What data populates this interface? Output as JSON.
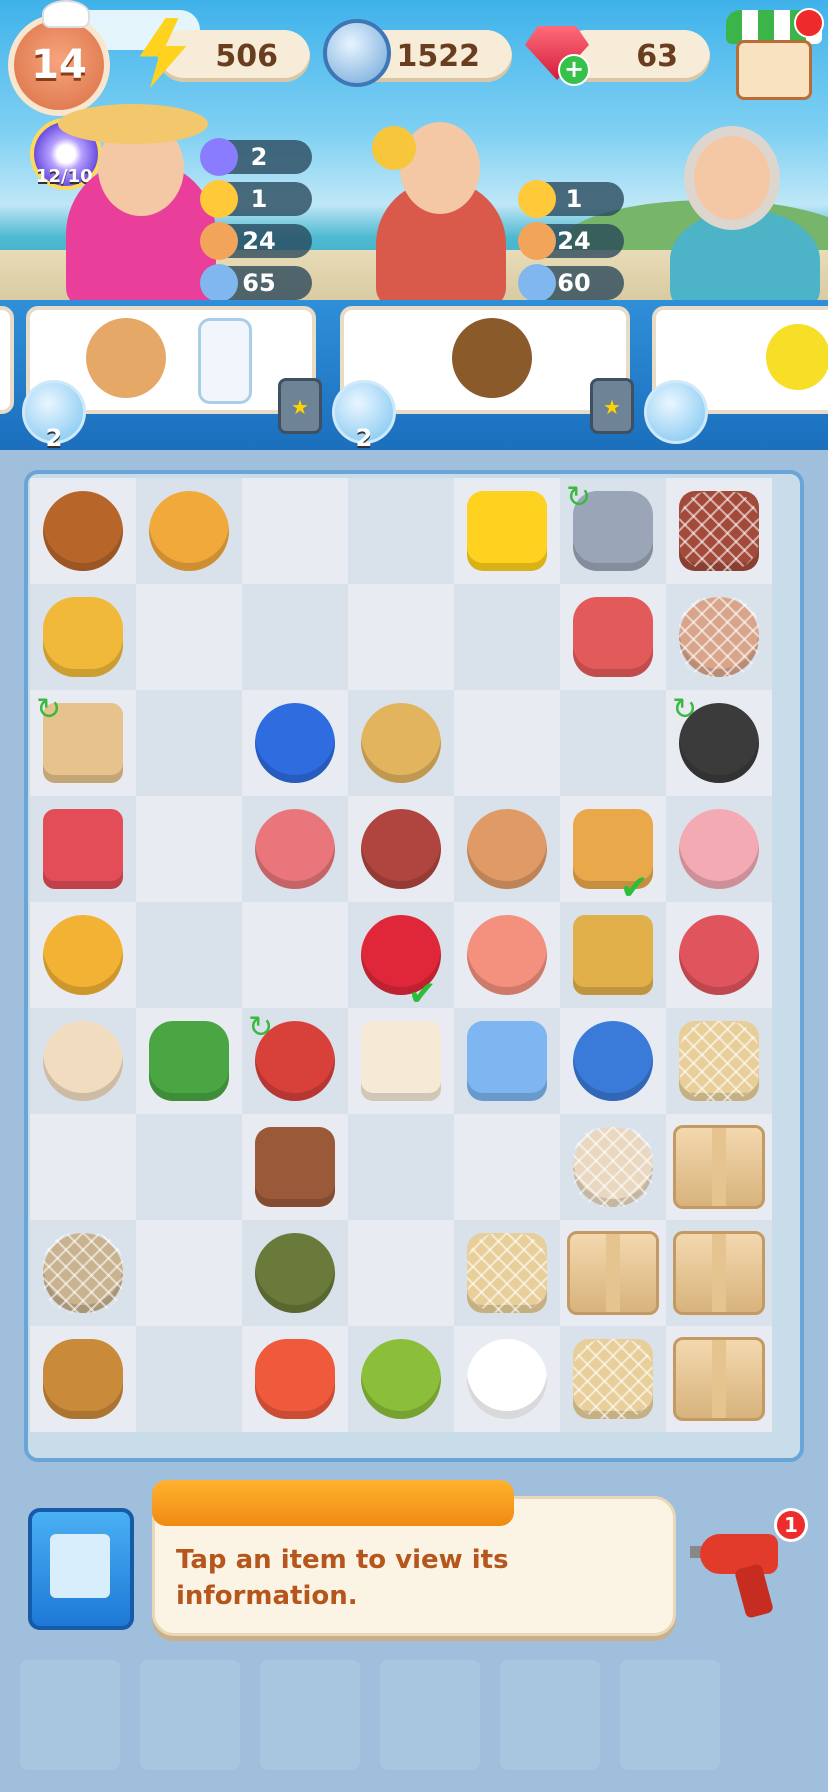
{
  "hud": {
    "level": "14",
    "energy": "506",
    "coins": "1522",
    "gems": "63"
  },
  "booster": {
    "count": "12/10"
  },
  "customers": [
    {
      "name": "customer-1",
      "stats": [
        "2",
        "1",
        "24",
        "65"
      ]
    },
    {
      "name": "customer-2",
      "stats": [
        "1",
        "24",
        "60"
      ]
    },
    {
      "name": "customer-3",
      "stats": []
    }
  ],
  "orders": [
    {
      "items": [
        "grilled-steak-icon",
        "milk-bottle-icon"
      ],
      "pet_count": "2"
    },
    {
      "items": [
        "hazelnut-icon"
      ],
      "pet_count": "2"
    },
    {
      "items": [
        "lemon-icon"
      ],
      "pet_count": ""
    }
  ],
  "board": {
    "rows": [
      [
        "mushroom",
        "mango",
        "",
        "",
        "energy",
        "juicer",
        "bacon-web"
      ],
      [
        "pineapple",
        "",
        "",
        "",
        "",
        "steak",
        "chicken-web"
      ],
      [
        "cutting-board",
        "",
        "blueberry",
        "peanut",
        "",
        "",
        "pan"
      ],
      [
        "ribs",
        "",
        "sausage",
        "ham",
        "egg",
        "sandwich",
        "drumstick"
      ],
      [
        "pasta",
        "",
        "",
        "strawberry",
        "salmon",
        "veg-box",
        "pork"
      ],
      [
        "dough",
        "herbs",
        "grill",
        "bag",
        "fish-box",
        "bowl",
        "cheese-web"
      ],
      [
        "",
        "",
        "cola",
        "",
        "",
        "cream-web",
        "box"
      ],
      [
        "clam-web",
        "",
        "crab",
        "",
        "cheese-web",
        "box",
        "box"
      ],
      [
        "fish",
        "",
        "red-fish",
        "shrimp",
        "coffee",
        "cheese-web",
        "box"
      ]
    ]
  },
  "info": {
    "text": "Tap an item to view its information."
  },
  "tool": {
    "badge": "1"
  }
}
